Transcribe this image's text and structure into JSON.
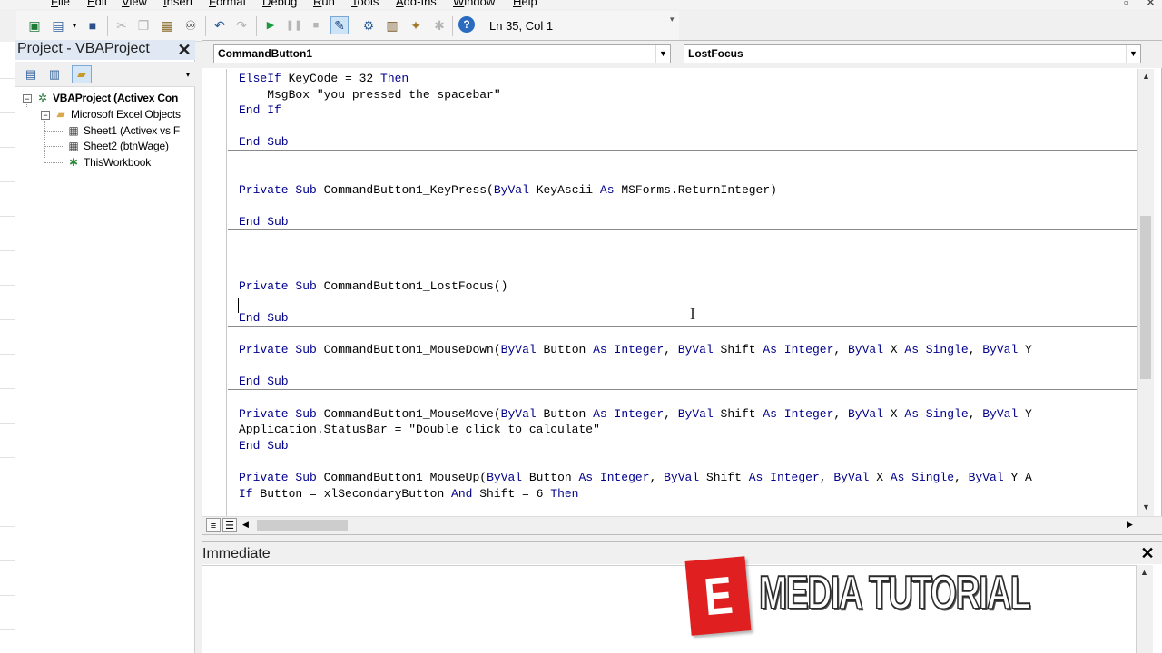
{
  "menubar": {
    "items": [
      "File",
      "Edit",
      "View",
      "Insert",
      "Format",
      "Debug",
      "Run",
      "Tools",
      "Add-Ins",
      "Window",
      "Help"
    ]
  },
  "toolbar": {
    "status": "Ln 35, Col 1"
  },
  "project": {
    "title": "Project - VBAProject",
    "tree": {
      "root": "VBAProject (Activex Con",
      "folder": "Microsoft Excel Objects",
      "items": [
        "Sheet1 (Activex vs F",
        "Sheet2 (btnWage)",
        "ThisWorkbook"
      ]
    }
  },
  "code": {
    "object_combo": "CommandButton1",
    "procedure_combo": "LostFocus",
    "lines": [
      [
        {
          "t": "ElseIf",
          "k": true
        },
        {
          "t": " KeyCode = 32 "
        },
        {
          "t": "Then",
          "k": true
        }
      ],
      [
        {
          "t": "    MsgBox \"you pressed the spacebar\""
        }
      ],
      [
        {
          "t": "End If",
          "k": true
        }
      ],
      [],
      [
        {
          "t": "End Sub",
          "k": true
        }
      ],
      "SEP",
      [],
      [],
      [
        {
          "t": "Private Sub",
          "k": true
        },
        {
          "t": " CommandButton1_KeyPress("
        },
        {
          "t": "ByVal",
          "k": true
        },
        {
          "t": " KeyAscii "
        },
        {
          "t": "As",
          "k": true
        },
        {
          "t": " MSForms.ReturnInteger)"
        }
      ],
      [],
      [
        {
          "t": "End Sub",
          "k": true
        }
      ],
      "SEP",
      [],
      [],
      [],
      [
        {
          "t": "Private Sub",
          "k": true
        },
        {
          "t": " CommandButton1_LostFocus()"
        }
      ],
      [],
      [
        {
          "t": "End Sub",
          "k": true
        }
      ],
      "SEP",
      [],
      [
        {
          "t": "Private Sub",
          "k": true
        },
        {
          "t": " CommandButton1_MouseDown("
        },
        {
          "t": "ByVal",
          "k": true
        },
        {
          "t": " Button "
        },
        {
          "t": "As Integer",
          "k": true
        },
        {
          "t": ", "
        },
        {
          "t": "ByVal",
          "k": true
        },
        {
          "t": " Shift "
        },
        {
          "t": "As Integer",
          "k": true
        },
        {
          "t": ", "
        },
        {
          "t": "ByVal",
          "k": true
        },
        {
          "t": " X "
        },
        {
          "t": "As Single",
          "k": true
        },
        {
          "t": ", "
        },
        {
          "t": "ByVal",
          "k": true
        },
        {
          "t": " Y"
        }
      ],
      [],
      [
        {
          "t": "End Sub",
          "k": true
        }
      ],
      "SEP",
      [],
      [
        {
          "t": "Private Sub",
          "k": true
        },
        {
          "t": " CommandButton1_MouseMove("
        },
        {
          "t": "ByVal",
          "k": true
        },
        {
          "t": " Button "
        },
        {
          "t": "As Integer",
          "k": true
        },
        {
          "t": ", "
        },
        {
          "t": "ByVal",
          "k": true
        },
        {
          "t": " Shift "
        },
        {
          "t": "As Integer",
          "k": true
        },
        {
          "t": ", "
        },
        {
          "t": "ByVal",
          "k": true
        },
        {
          "t": " X "
        },
        {
          "t": "As Single",
          "k": true
        },
        {
          "t": ", "
        },
        {
          "t": "ByVal",
          "k": true
        },
        {
          "t": " Y"
        }
      ],
      [
        {
          "t": "Application.StatusBar = \"Double click to calculate\""
        }
      ],
      [
        {
          "t": "End Sub",
          "k": true
        }
      ],
      "SEP",
      [],
      [
        {
          "t": "Private Sub",
          "k": true
        },
        {
          "t": " CommandButton1_MouseUp("
        },
        {
          "t": "ByVal",
          "k": true
        },
        {
          "t": " Button "
        },
        {
          "t": "As Integer",
          "k": true
        },
        {
          "t": ", "
        },
        {
          "t": "ByVal",
          "k": true
        },
        {
          "t": " Shift "
        },
        {
          "t": "As Integer",
          "k": true
        },
        {
          "t": ", "
        },
        {
          "t": "ByVal",
          "k": true
        },
        {
          "t": " X "
        },
        {
          "t": "As Single",
          "k": true
        },
        {
          "t": ", "
        },
        {
          "t": "ByVal",
          "k": true
        },
        {
          "t": " Y A"
        }
      ],
      [
        {
          "t": "If",
          "k": true
        },
        {
          "t": " Button = xlSecondaryButton "
        },
        {
          "t": "And",
          "k": true
        },
        {
          "t": " Shift = 6 "
        },
        {
          "t": "Then",
          "k": true
        }
      ]
    ]
  },
  "immediate": {
    "title": "Immediate"
  },
  "logo": {
    "letter": "E",
    "text": "MEDIA TUTORIAL",
    "color": "#e02020"
  },
  "colors": {
    "keyword": "#00008b",
    "title_bar": "#dfe8f3"
  }
}
